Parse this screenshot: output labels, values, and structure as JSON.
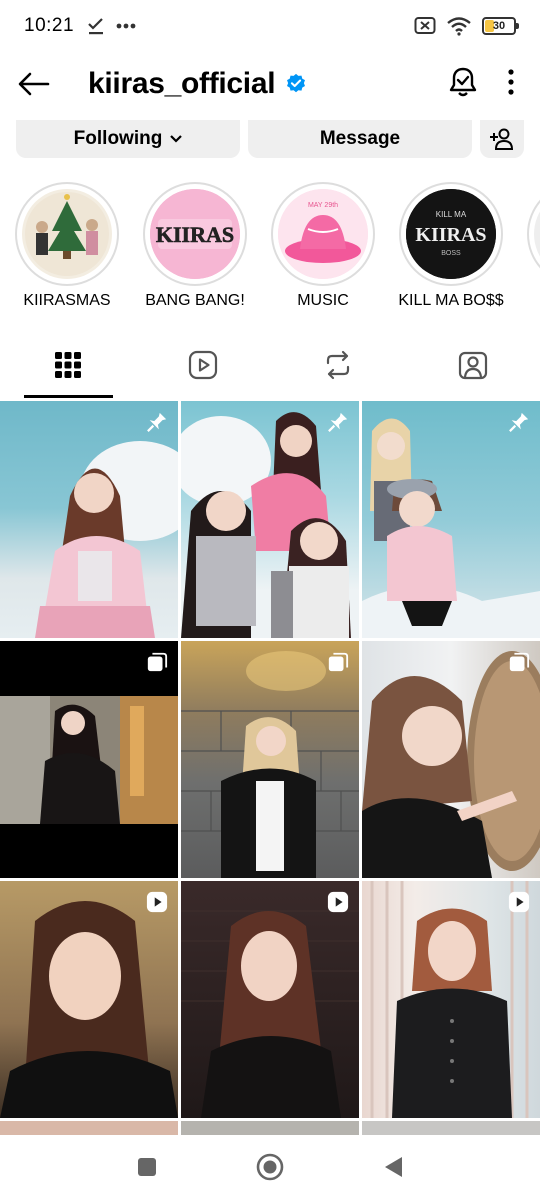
{
  "status_bar": {
    "time": "10:21",
    "battery_level": "30",
    "battery_percent": 30
  },
  "profile": {
    "username": "kiiras_official"
  },
  "actions": {
    "following_label": "Following",
    "message_label": "Message"
  },
  "highlights": [
    {
      "label": "KIIRASMAS"
    },
    {
      "label": "BANG BANG!"
    },
    {
      "label": "MUSIC"
    },
    {
      "label": "KILL MA BO$$"
    }
  ],
  "colors": {
    "accent": "#0095f6",
    "battery": "#f6c543",
    "pill_bg": "#efefef"
  },
  "tabs": [
    {
      "name": "posts-grid",
      "icon": "grid-icon",
      "active": true
    },
    {
      "name": "reels",
      "icon": "reels-icon",
      "active": false
    },
    {
      "name": "reposts",
      "icon": "repost-icon",
      "active": false
    },
    {
      "name": "tagged",
      "icon": "tagged-person-icon",
      "active": false
    }
  ],
  "posts": [
    {
      "badge": "pin-icon"
    },
    {
      "badge": "pin-icon"
    },
    {
      "badge": "pin-icon"
    },
    {
      "badge": "carousel-icon"
    },
    {
      "badge": "carousel-icon"
    },
    {
      "badge": "carousel-icon"
    },
    {
      "badge": "reel-play-icon"
    },
    {
      "badge": "reel-play-icon"
    },
    {
      "badge": "reel-play-icon"
    }
  ]
}
